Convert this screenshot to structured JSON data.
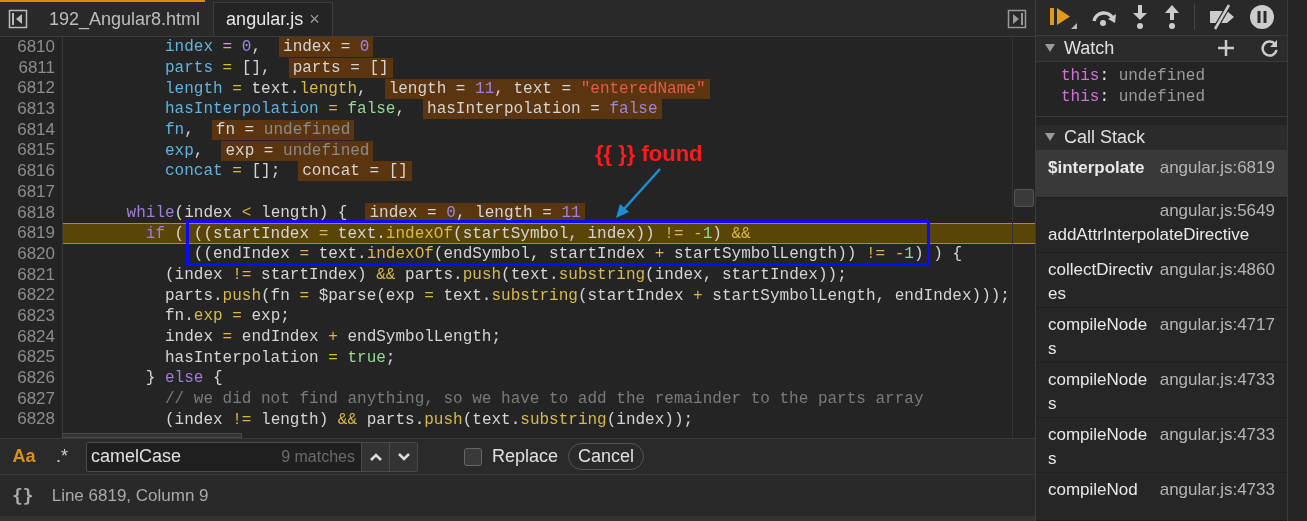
{
  "tabs": [
    {
      "label": "192_Angular8.html",
      "selected": false
    },
    {
      "label": "angular.js",
      "selected": true,
      "close": "×"
    }
  ],
  "code_lines": [
    {
      "number": "6810",
      "current": false,
      "kind": "body",
      "tokens": [
        {
          "kind": "var",
          "text": "index"
        },
        {
          "kind": "op",
          "text": " = "
        },
        {
          "kind": "num",
          "text": "0"
        },
        {
          "kind": "plain",
          "text": ","
        }
      ],
      "inline": [
        {
          "kind": "plain",
          "text": "index = "
        },
        {
          "kind": "num",
          "text": "0"
        }
      ]
    },
    {
      "number": "6811",
      "current": false,
      "kind": "body",
      "tokens": [
        {
          "kind": "var",
          "text": "parts"
        },
        {
          "kind": "op",
          "text": " = "
        },
        {
          "kind": "plain",
          "text": "[],"
        }
      ],
      "inline": [
        {
          "kind": "plain",
          "text": "parts = []"
        }
      ]
    },
    {
      "number": "6812",
      "current": false,
      "kind": "body",
      "tokens": [
        {
          "kind": "var",
          "text": "length"
        },
        {
          "kind": "op",
          "text": " = "
        },
        {
          "kind": "plain",
          "text": "text."
        },
        {
          "kind": "func",
          "text": "length"
        },
        {
          "kind": "plain",
          "text": ","
        }
      ],
      "inline": [
        {
          "kind": "plain",
          "text": "length = "
        },
        {
          "kind": "num",
          "text": "11"
        },
        {
          "kind": "plain",
          "text": ", text = "
        },
        {
          "kind": "str",
          "text": "\"enteredName\""
        }
      ]
    },
    {
      "number": "6813",
      "current": false,
      "kind": "body",
      "tokens": [
        {
          "kind": "var",
          "text": "hasInterpolation"
        },
        {
          "kind": "op",
          "text": " = "
        },
        {
          "kind": "bool",
          "text": "false"
        },
        {
          "kind": "plain",
          "text": ","
        }
      ],
      "inline": [
        {
          "kind": "plain",
          "text": "hasInterpolation = "
        },
        {
          "kind": "num",
          "text": "false"
        }
      ]
    },
    {
      "number": "6814",
      "current": false,
      "kind": "body",
      "tokens": [
        {
          "kind": "var",
          "text": "fn"
        },
        {
          "kind": "plain",
          "text": ","
        }
      ],
      "inline": [
        {
          "kind": "plain",
          "text": "fn = "
        },
        {
          "kind": "undef",
          "text": "undefined"
        }
      ]
    },
    {
      "number": "6815",
      "current": false,
      "kind": "body",
      "tokens": [
        {
          "kind": "var",
          "text": "exp"
        },
        {
          "kind": "plain",
          "text": ","
        }
      ],
      "inline": [
        {
          "kind": "plain",
          "text": "exp = "
        },
        {
          "kind": "undef",
          "text": "undefined"
        }
      ]
    },
    {
      "number": "6816",
      "current": false,
      "kind": "body",
      "tokens": [
        {
          "kind": "var",
          "text": "concat"
        },
        {
          "kind": "op",
          "text": " = "
        },
        {
          "kind": "plain",
          "text": "[];"
        }
      ],
      "inline": [
        {
          "kind": "plain",
          "text": "concat = []"
        }
      ]
    },
    {
      "number": "6817",
      "current": false
    },
    {
      "number": "6818",
      "current": false,
      "kind": "loop",
      "tokens": [
        {
          "kind": "keyword",
          "text": "while"
        },
        {
          "kind": "plain",
          "text": "(index "
        },
        {
          "kind": "op",
          "text": "<"
        },
        {
          "kind": "plain",
          "text": " length) {"
        }
      ],
      "inline": [
        {
          "kind": "plain",
          "text": "index = "
        },
        {
          "kind": "num",
          "text": "0"
        },
        {
          "kind": "plain",
          "text": ", length = "
        },
        {
          "kind": "num",
          "text": "11"
        }
      ]
    },
    {
      "number": "6819",
      "current": true,
      "kind": "branch",
      "tokens": [
        {
          "kind": "keyword",
          "text": "if"
        },
        {
          "kind": "plain",
          "text": " ( ((startIndex "
        },
        {
          "kind": "op",
          "text": "="
        },
        {
          "kind": "plain",
          "text": " text."
        },
        {
          "kind": "func",
          "text": "indexOf"
        },
        {
          "kind": "plain",
          "text": "(startSymbol, index)) "
        },
        {
          "kind": "op",
          "text": "!= -"
        },
        {
          "kind": "bool",
          "text": "1"
        },
        {
          "kind": "plain",
          "text": ") "
        },
        {
          "kind": "op",
          "text": "&&"
        }
      ]
    },
    {
      "number": "6820",
      "current": false,
      "kind": "continuation",
      "tokens": [
        {
          "kind": "plain",
          "text": "((endIndex "
        },
        {
          "kind": "op",
          "text": "="
        },
        {
          "kind": "plain",
          "text": " text."
        },
        {
          "kind": "func",
          "text": "indexOf"
        },
        {
          "kind": "plain",
          "text": "(endSymbol, startIndex "
        },
        {
          "kind": "op",
          "text": "+"
        },
        {
          "kind": "plain",
          "text": " startSymbolLength)) "
        },
        {
          "kind": "op",
          "text": "!= -"
        },
        {
          "kind": "bool",
          "text": "1"
        },
        {
          "kind": "plain",
          "text": ") ) {"
        }
      ]
    },
    {
      "number": "6821",
      "current": false,
      "kind": "body",
      "tokens": [
        {
          "kind": "plain",
          "text": "(index "
        },
        {
          "kind": "op",
          "text": "!="
        },
        {
          "kind": "plain",
          "text": " startIndex) "
        },
        {
          "kind": "op",
          "text": "&&"
        },
        {
          "kind": "plain",
          "text": " parts."
        },
        {
          "kind": "func",
          "text": "push"
        },
        {
          "kind": "plain",
          "text": "(text."
        },
        {
          "kind": "func",
          "text": "substring"
        },
        {
          "kind": "plain",
          "text": "(index, startIndex));"
        }
      ]
    },
    {
      "number": "6822",
      "current": false,
      "kind": "body",
      "tokens": [
        {
          "kind": "plain",
          "text": "parts."
        },
        {
          "kind": "func",
          "text": "push"
        },
        {
          "kind": "plain",
          "text": "(fn "
        },
        {
          "kind": "op",
          "text": "="
        },
        {
          "kind": "plain",
          "text": " $parse(exp "
        },
        {
          "kind": "op",
          "text": "="
        },
        {
          "kind": "plain",
          "text": " text."
        },
        {
          "kind": "func",
          "text": "substring"
        },
        {
          "kind": "plain",
          "text": "(startIndex "
        },
        {
          "kind": "op",
          "text": "+"
        },
        {
          "kind": "plain",
          "text": " startSymbolLength, endIndex)));"
        }
      ]
    },
    {
      "number": "6823",
      "current": false,
      "kind": "body",
      "tokens": [
        {
          "kind": "plain",
          "text": "fn."
        },
        {
          "kind": "func",
          "text": "exp"
        },
        {
          "kind": "op",
          "text": " = "
        },
        {
          "kind": "plain",
          "text": "exp;"
        }
      ]
    },
    {
      "number": "6824",
      "current": false,
      "kind": "body",
      "tokens": [
        {
          "kind": "plain",
          "text": "index "
        },
        {
          "kind": "op",
          "text": "="
        },
        {
          "kind": "plain",
          "text": " endIndex "
        },
        {
          "kind": "op",
          "text": "+"
        },
        {
          "kind": "plain",
          "text": " endSymbolLength;"
        }
      ]
    },
    {
      "number": "6825",
      "current": false,
      "kind": "body",
      "tokens": [
        {
          "kind": "plain",
          "text": "hasInterpolation"
        },
        {
          "kind": "op",
          "text": " = "
        },
        {
          "kind": "bool",
          "text": "true"
        },
        {
          "kind": "plain",
          "text": ";"
        }
      ]
    },
    {
      "number": "6826",
      "current": false,
      "kind": "branch",
      "tokens": [
        {
          "kind": "plain",
          "text": "} "
        },
        {
          "kind": "keyword",
          "text": "else"
        },
        {
          "kind": "plain",
          "text": " {"
        }
      ]
    },
    {
      "number": "6827",
      "current": false,
      "kind": "body",
      "tokens": [
        {
          "kind": "comment",
          "text": "// we did not find anything, so we have to add the remainder to the parts array"
        }
      ]
    },
    {
      "number": "6828",
      "current": false,
      "kind": "body",
      "tokens": [
        {
          "kind": "plain",
          "text": "(index "
        },
        {
          "kind": "op",
          "text": "!="
        },
        {
          "kind": "plain",
          "text": " length) "
        },
        {
          "kind": "op",
          "text": "&&"
        },
        {
          "kind": "plain",
          "text": " parts."
        },
        {
          "kind": "func",
          "text": "push"
        },
        {
          "kind": "plain",
          "text": "(text."
        },
        {
          "kind": "func",
          "text": "substring"
        },
        {
          "kind": "plain",
          "text": "(index));"
        }
      ]
    }
  ],
  "annotation": {
    "text": "{{ }} found"
  },
  "search": {
    "case_toggle": {
      "label": "Aa",
      "on": true
    },
    "regex_toggle": {
      "label": ".*",
      "on": false
    },
    "value": "camelCase",
    "count": "9 matches",
    "replace": {
      "label": "Replace",
      "checked": false
    },
    "cancel": "Cancel"
  },
  "status_bar": {
    "format_icon": "{}",
    "position": "Line 6819, Column 9"
  },
  "watch": {
    "title": "Watch",
    "expanded": true,
    "items": [
      {
        "name": "this",
        "separator": ":",
        "value": "undefined"
      },
      {
        "name": "this",
        "separator": ":",
        "value": "undefined"
      }
    ]
  },
  "call_stack": {
    "title": "Call Stack",
    "expanded": true,
    "frames": [
      {
        "name": "$interpolate",
        "location": "angular.js:6819",
        "selected": true,
        "kind": "beside"
      },
      {
        "name": "addAttrInterpolateDirective",
        "location": "angular.js:5649",
        "selected": false,
        "kind": "below"
      },
      {
        "name": "collectDirectives",
        "location": "angular.js:4860",
        "selected": false,
        "kind": "beside"
      },
      {
        "name": "compileNodes",
        "location": "angular.js:4717",
        "selected": false,
        "kind": "beside"
      },
      {
        "name": "compileNodes",
        "location": "angular.js:4733",
        "selected": false,
        "kind": "beside"
      },
      {
        "name": "compileNodes",
        "location": "angular.js:4733",
        "selected": false,
        "kind": "beside"
      },
      {
        "name": "compileNod",
        "location": "angular.js:4733",
        "selected": false,
        "kind": "beside"
      }
    ]
  }
}
